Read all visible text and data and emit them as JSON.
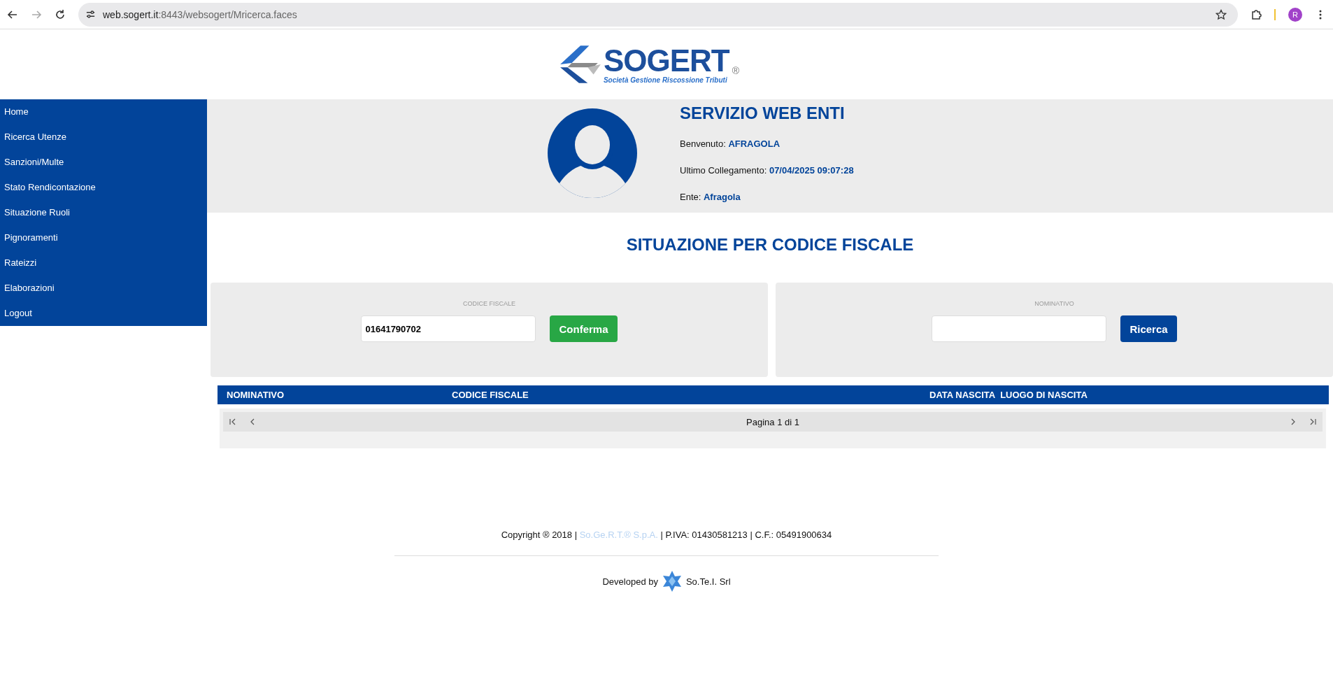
{
  "browser": {
    "url_host": "web.sogert.it",
    "url_path": ":8443/websogert/Mricerca.faces",
    "profile_initial": "R"
  },
  "logo": {
    "name": "SOGERT",
    "mark": "®",
    "tagline": "**S**ocietà **G**estione **R**iscossione **T**ributi"
  },
  "sidebar": {
    "items": [
      {
        "label": "Home"
      },
      {
        "label": "Ricerca Utenze"
      },
      {
        "label": "Sanzioni/Multe"
      },
      {
        "label": "Stato Rendicontazione"
      },
      {
        "label": "Situazione Ruoli"
      },
      {
        "label": "Pignoramenti"
      },
      {
        "label": "Rateizzi"
      },
      {
        "label": "Elaborazioni"
      },
      {
        "label": "Logout"
      }
    ]
  },
  "user_panel": {
    "title": "SERVIZIO WEB ENTI",
    "fields": [
      {
        "label": "Benvenuto:",
        "value": "AFRAGOLA"
      },
      {
        "label": "Ultimo Collegamento:",
        "value": "07/04/2025 09:07:28"
      },
      {
        "label": "Ente:",
        "value": "Afragola"
      }
    ]
  },
  "page_title": "SITUAZIONE PER CODICE FISCALE",
  "search_panels": [
    {
      "label": "CODICE FISCALE",
      "value": "01641790702",
      "button": "Conferma",
      "kind": "confirm"
    },
    {
      "label": "NOMINATIVO",
      "button": "Ricerca",
      "kind": "search"
    }
  ],
  "table": {
    "columns": [
      "NOMINATIVO",
      "CODICE FISCALE",
      "DATA NASCITA",
      "LUOGO DI NASCITA"
    ],
    "pager": "Pagina 1 di 1"
  },
  "footer": {
    "copyright_start": "Copyright ® 2018 |",
    "company_link": "So.Ge.R.T.® S.p.A.",
    "copyright_end": "| P.IVA: 01430581213 | C.F.: 05491900634",
    "developed_by": "Developed by",
    "developer": "So.Te.I. Srl"
  }
}
